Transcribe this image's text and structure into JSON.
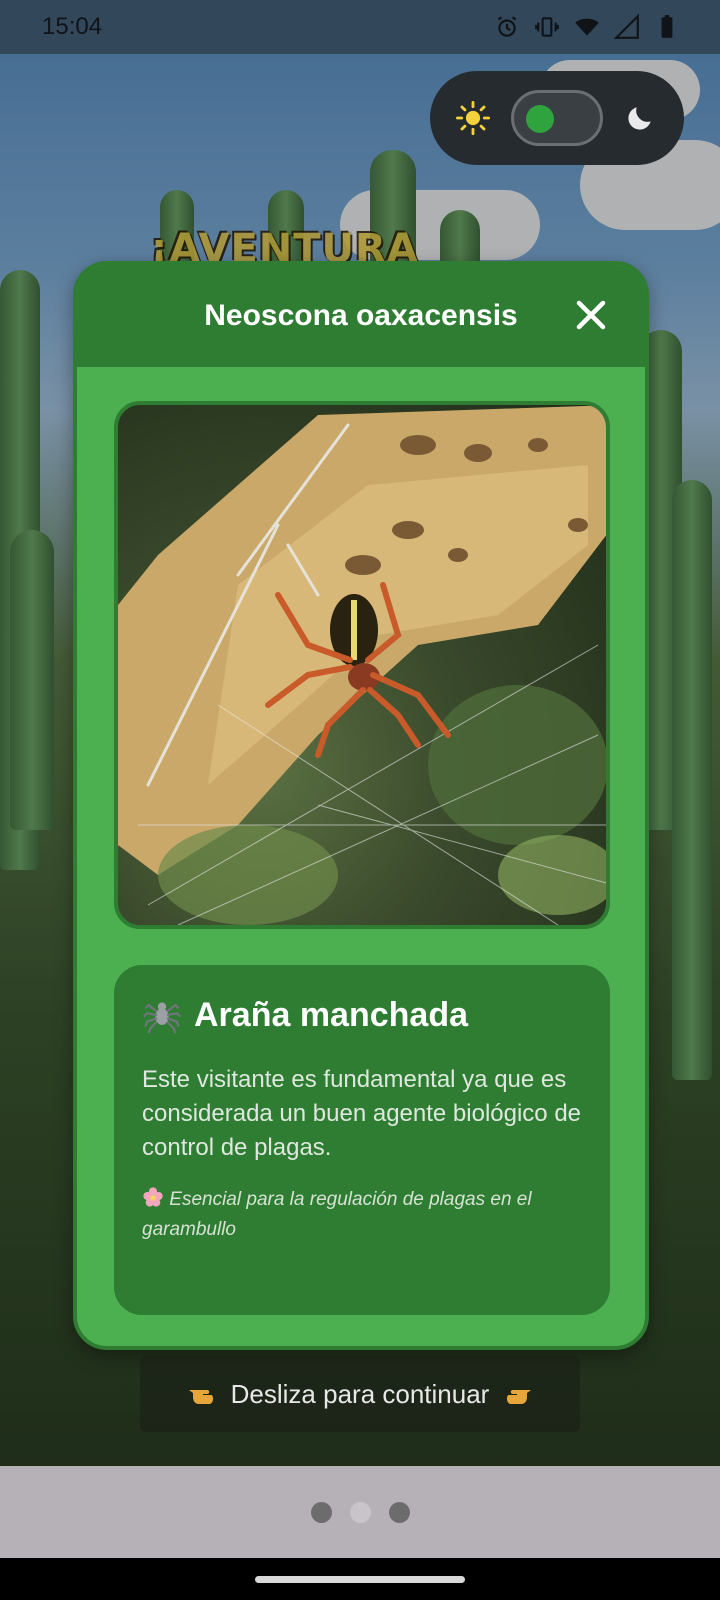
{
  "status_bar": {
    "time": "15:04",
    "icons": [
      "alarm-icon",
      "vibrate-icon",
      "wifi-icon",
      "signal-icon",
      "battery-icon"
    ]
  },
  "background": {
    "logo_text": "¡AVENTURA",
    "sky_color": "#7fb0dc",
    "cactus_color": "#5a8f57"
  },
  "theme_toggle": {
    "light_icon": "sun-icon",
    "dark_icon": "moon-icon",
    "state": "light",
    "knob_color": "#2fa33e"
  },
  "modal": {
    "title": "Neoscona oaxacensis",
    "close_icon": "close-icon",
    "image_subject": "spider-photo",
    "card": {
      "icon": "spider-icon",
      "title": "Araña manchada",
      "description": "Este visitante es fundamental ya que es considerada un buen agente biológico de control de plagas.",
      "note_icon": "flower-icon",
      "note": "Esencial para la regulación de plagas en el garambullo"
    },
    "colors": {
      "header": "#2e7d32",
      "body": "#4caf50",
      "card": "#2e7d32"
    }
  },
  "swipe_hint": {
    "text": "Desliza para continuar",
    "left_icon": "pointing-hand-left-icon",
    "right_icon": "pointing-hand-right-icon"
  },
  "pager": {
    "total": 3,
    "active_index": 1
  }
}
